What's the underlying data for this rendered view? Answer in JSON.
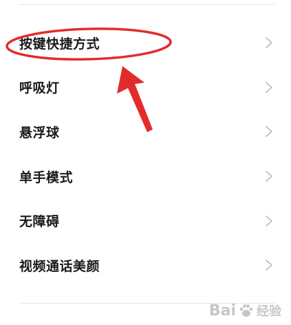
{
  "menu": {
    "items": [
      {
        "label": "按键快捷方式"
      },
      {
        "label": "呼吸灯"
      },
      {
        "label": "悬浮球"
      },
      {
        "label": "单手模式"
      },
      {
        "label": "无障碍"
      },
      {
        "label": "视频通话美颜"
      }
    ]
  },
  "icons": {
    "row_chevron": "chevron-right-icon"
  },
  "annotation": {
    "color": "#e32b2b"
  },
  "watermark": {
    "text": "Bai",
    "text2": "经验"
  },
  "colors": {
    "background": "#ffffff",
    "text": "#1a1a1a",
    "chevron": "#bdbdbd",
    "divider": "#e6e6e6"
  }
}
